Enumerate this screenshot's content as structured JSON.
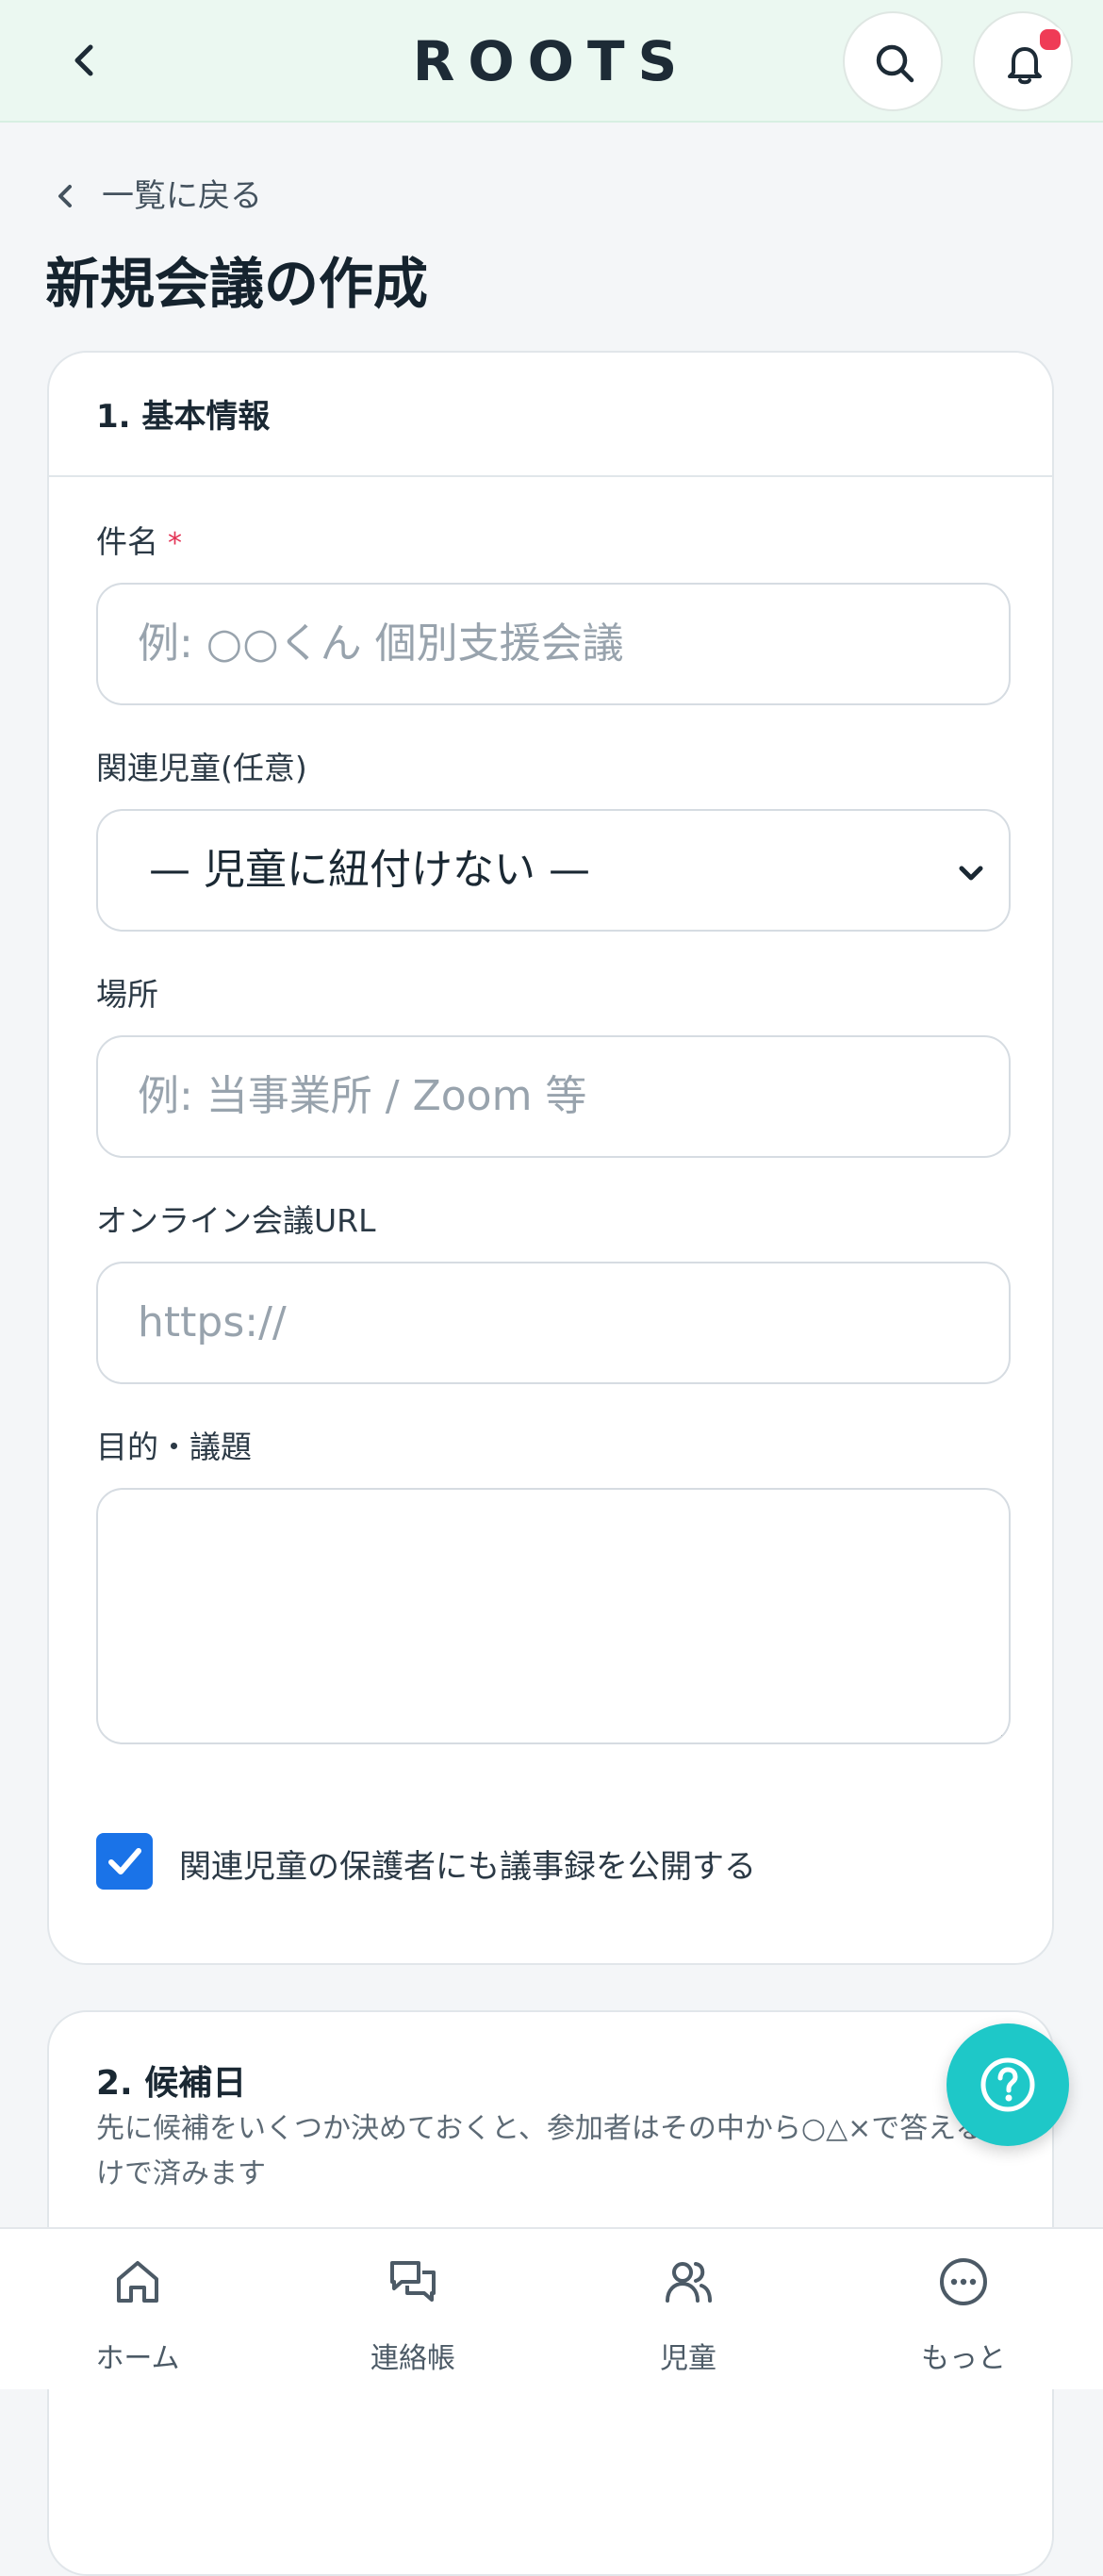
{
  "header": {
    "brand": "ROOTS"
  },
  "nav": {
    "back_label": "一覧に戻る"
  },
  "page": {
    "title": "新規会議の作成"
  },
  "section1": {
    "title": "1. 基本情報",
    "subject": {
      "label": "件名",
      "required_mark": "*",
      "placeholder": "例: ○○くん 個別支援会議"
    },
    "child": {
      "label": "関連児童(任意)",
      "selected": "— 児童に紐付けない —"
    },
    "place": {
      "label": "場所",
      "placeholder": "例: 当事業所 / Zoom 等"
    },
    "url": {
      "label": "オンライン会議URL",
      "placeholder": "https://"
    },
    "agenda": {
      "label": "目的・議題",
      "value": ""
    },
    "share": {
      "label": "関連児童の保護者にも議事録を公開する",
      "checked": true
    }
  },
  "section2": {
    "title": "2. 候補日",
    "description": "先に候補をいくつか決めておくと、参加者はその中から○△×で答えるだけで済みます"
  },
  "tabbar": {
    "items": [
      {
        "label": "ホーム",
        "icon": "home-icon"
      },
      {
        "label": "連絡帳",
        "icon": "chat-icon"
      },
      {
        "label": "児童",
        "icon": "users-icon"
      },
      {
        "label": "もっと",
        "icon": "more-icon"
      }
    ]
  },
  "colors": {
    "header_bg": "#ebf8f1",
    "accent": "#1a73e8",
    "fab": "#1ec8c8",
    "notification": "#ef3b56",
    "required": "#e33355"
  }
}
